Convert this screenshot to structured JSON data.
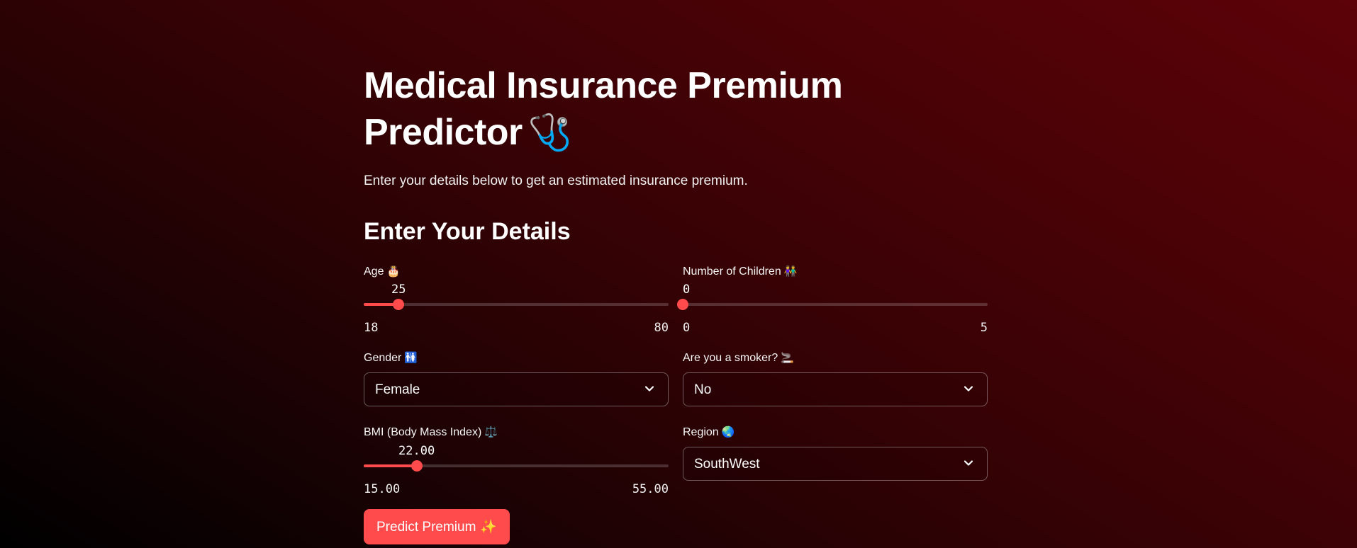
{
  "header": {
    "title": "Medical Insurance Premium Predictor",
    "title_emoji": "🩺",
    "subtitle": "Enter your details below to get an estimated insurance premium."
  },
  "form": {
    "section_title": "Enter Your Details",
    "age": {
      "label": "Age",
      "emoji": "🎂",
      "value": "25",
      "min": "18",
      "max": "80",
      "fraction": 0.113
    },
    "children": {
      "label": "Number of Children",
      "emoji": "👫",
      "value": "0",
      "min": "0",
      "max": "5",
      "fraction": 0
    },
    "gender": {
      "label": "Gender",
      "emoji": "🚻",
      "selected": "Female"
    },
    "smoker": {
      "label": "Are you a smoker?",
      "emoji": "🚬",
      "selected": "No"
    },
    "bmi": {
      "label": "BMI (Body Mass Index)",
      "emoji": "⚖️",
      "value": "22.00",
      "min": "15.00",
      "max": "55.00",
      "fraction": 0.175
    },
    "region": {
      "label": "Region",
      "emoji": "🌏",
      "selected": "SouthWest"
    },
    "predict_button": {
      "label": "Predict Premium",
      "emoji": "✨"
    }
  },
  "colors": {
    "accent": "#ff4b4b",
    "text": "#ffffff"
  }
}
